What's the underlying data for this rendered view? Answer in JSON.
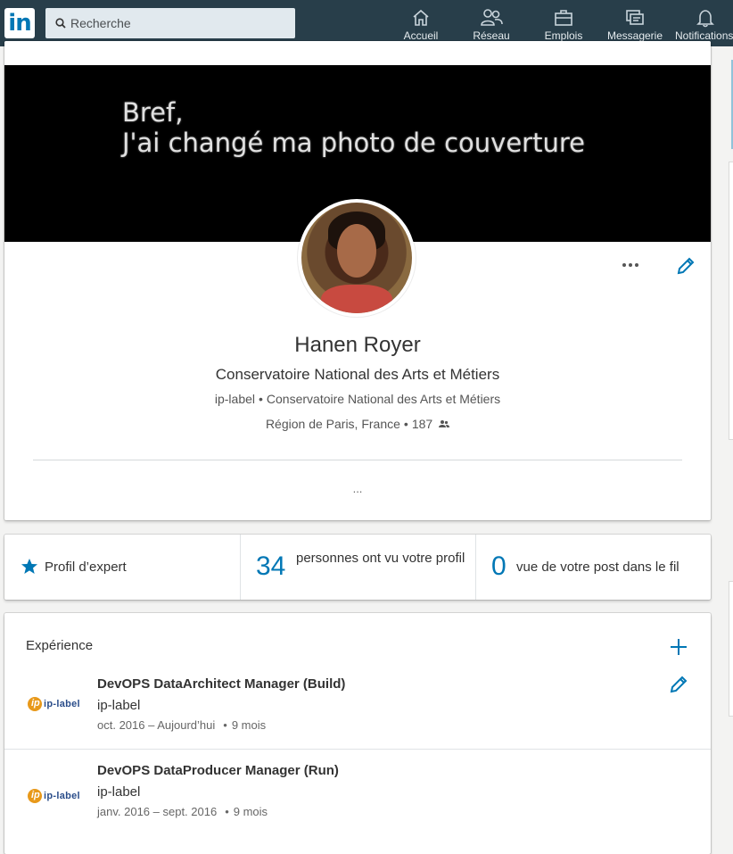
{
  "nav": {
    "search_placeholder": "Recherche",
    "items": [
      {
        "label": "Accueil",
        "icon": "home-icon"
      },
      {
        "label": "Réseau",
        "icon": "network-icon"
      },
      {
        "label": "Emplois",
        "icon": "briefcase-icon"
      },
      {
        "label": "Messagerie",
        "icon": "messaging-icon"
      },
      {
        "label": "Notifications",
        "icon": "bell-icon"
      }
    ],
    "active": "Messagerie",
    "colors": {
      "bar": "#283e4a",
      "accent": "#0077b5"
    }
  },
  "profile": {
    "cover_line1": "Bref,",
    "cover_line2": "J'ai changé ma photo de couverture",
    "name": "Hanen Royer",
    "headline": "Conservatoire National des Arts et Métiers",
    "company": "ip-label",
    "school": "Conservatoire National des Arts et Métiers",
    "location": "Région de Paris, France",
    "connections": "187",
    "more": "..."
  },
  "stats": {
    "expert_label": "Profil d’expert",
    "views_count": "34",
    "views_label": "personnes ont vu votre profil",
    "post_views_count": "0",
    "post_views_label": "vue de votre post dans le fil"
  },
  "experience": {
    "heading": "Expérience",
    "positions": [
      {
        "title": "DevOPS DataArchitect Manager (Build)",
        "company": "ip-label",
        "dates": "oct. 2016 – Aujourd’hui",
        "duration": "9 mois",
        "logo_text": "ip-label"
      },
      {
        "title": "DevOPS DataProducer Manager (Run)",
        "company": "ip-label",
        "dates": "janv. 2016 – sept. 2016",
        "duration": "9 mois",
        "logo_text": "ip-label"
      }
    ]
  }
}
